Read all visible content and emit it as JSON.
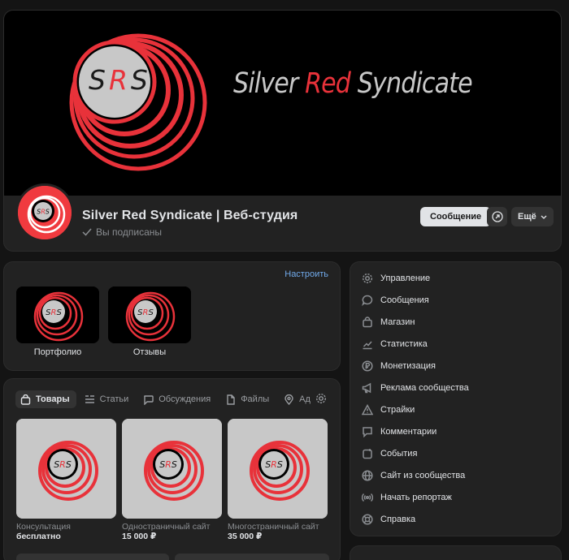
{
  "cover": {
    "logo_letters": [
      "S",
      "R",
      "S"
    ],
    "title_part1": "Silver ",
    "title_part2": "Red",
    "title_part3": " Syndicate"
  },
  "header": {
    "group_name": "Silver Red Syndicate | Веб-студия",
    "subscribed_label": "Вы подписаны",
    "message_button": "Сообщение",
    "more_button": "Ещё"
  },
  "albums": {
    "configure_link": "Настроить",
    "items": [
      {
        "label": "Портфолио"
      },
      {
        "label": "Отзывы"
      }
    ]
  },
  "goods": {
    "tabs": [
      {
        "label": "Товары",
        "icon": "bag-icon"
      },
      {
        "label": "Статьи",
        "icon": "article-icon"
      },
      {
        "label": "Обсуждения",
        "icon": "chat-bubble-icon"
      },
      {
        "label": "Файлы",
        "icon": "file-icon"
      },
      {
        "label": "Ад",
        "icon": "location-pin-icon"
      }
    ],
    "products": [
      {
        "title": "Консультация",
        "price": "бесплатно"
      },
      {
        "title": "Одностраничный сайт",
        "price": "15 000 ₽"
      },
      {
        "title": "Многостраничный сайт",
        "price": "35 000 ₽"
      }
    ]
  },
  "menu": {
    "items": [
      {
        "label": "Управление",
        "icon": "gear-icon"
      },
      {
        "label": "Сообщения",
        "icon": "message-icon"
      },
      {
        "label": "Магазин",
        "icon": "shopping-bag-icon"
      },
      {
        "label": "Статистика",
        "icon": "statistics-icon"
      },
      {
        "label": "Монетизация",
        "icon": "ruble-coin-icon"
      },
      {
        "label": "Реклама сообщества",
        "icon": "megaphone-icon"
      },
      {
        "label": "Страйки",
        "icon": "warning-icon"
      },
      {
        "label": "Комментарии",
        "icon": "comment-icon"
      },
      {
        "label": "События",
        "icon": "calendar-icon"
      },
      {
        "label": "Сайт из сообщества",
        "icon": "globe-icon"
      },
      {
        "label": "Начать репортаж",
        "icon": "broadcast-icon"
      },
      {
        "label": "Справка",
        "icon": "help-lifebuoy-icon"
      }
    ]
  },
  "colors": {
    "accent_red": "#e8323a",
    "link_blue": "#71aaeb",
    "card_bg": "#222222",
    "page_bg": "#141414"
  }
}
